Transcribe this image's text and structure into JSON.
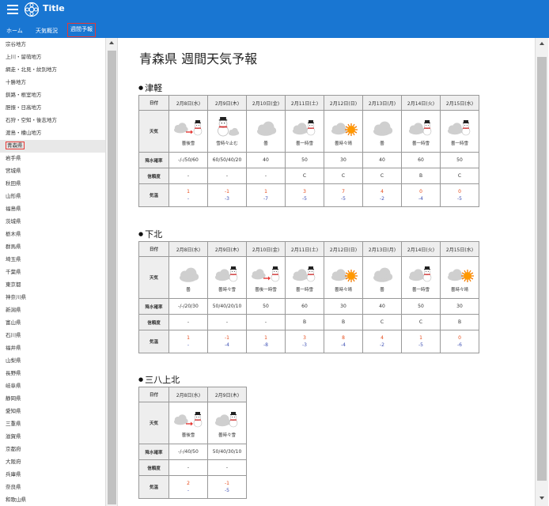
{
  "app": {
    "title": "Title"
  },
  "nav": {
    "tabs": [
      {
        "label": "ホーム"
      },
      {
        "label": "天気概況"
      },
      {
        "label": "週間予報"
      }
    ]
  },
  "sidebar": {
    "items": [
      "宗谷地方",
      "上川・留萌地方",
      "網走・北見・紋別地方",
      "十勝地方",
      "釧路・根室地方",
      "胆振・日高地方",
      "石狩・空知・後志地方",
      "渡島・檜山地方",
      "青森県",
      "岩手県",
      "宮城県",
      "秋田県",
      "山形県",
      "福島県",
      "茨城県",
      "栃木県",
      "群馬県",
      "埼玉県",
      "千葉県",
      "東京都",
      "神奈川県",
      "新潟県",
      "富山県",
      "石川県",
      "福井県",
      "山梨県",
      "長野県",
      "岐阜県",
      "静岡県",
      "愛知県",
      "三重県",
      "滋賀県",
      "京都府",
      "大阪府",
      "兵庫県",
      "奈良県",
      "和歌山県"
    ],
    "selected_index": 8
  },
  "page": {
    "title": "青森県 週間天気予報"
  },
  "labels": {
    "date": "日付",
    "weather": "天気",
    "pop": "降水確率",
    "reliability": "信頼度",
    "temp": "気温"
  },
  "colors": {
    "topbar": "#1976d2",
    "max_temp": "#e64a19",
    "min_temp": "#3f51b5",
    "selected_border": "#e53935"
  },
  "regions": [
    {
      "name": "津軽",
      "days": [
        {
          "date": "2月8日(水)",
          "icon": "cloudy-then-snow-icon",
          "weather": "曇後雪",
          "pop": "-/-/50/60",
          "rel": "-",
          "max": "1",
          "min": "-"
        },
        {
          "date": "2月9日(木)",
          "icon": "snow-sometimes-cloudy-icon",
          "weather": "雪時々止む",
          "pop": "60/50/40/20",
          "rel": "-",
          "max": "-1",
          "min": "-3"
        },
        {
          "date": "2月10日(金)",
          "icon": "cloudy-icon",
          "weather": "曇",
          "pop": "40",
          "rel": "-",
          "max": "1",
          "min": "-7"
        },
        {
          "date": "2月11日(土)",
          "icon": "cloudy-occasional-snow-icon",
          "weather": "曇一時雪",
          "pop": "50",
          "rel": "C",
          "max": "3",
          "min": "-5"
        },
        {
          "date": "2月12日(日)",
          "icon": "cloudy-sometimes-sunny-icon",
          "weather": "曇時々晴",
          "pop": "30",
          "rel": "C",
          "max": "7",
          "min": "-5"
        },
        {
          "date": "2月13日(月)",
          "icon": "cloudy-icon",
          "weather": "曇",
          "pop": "40",
          "rel": "C",
          "max": "4",
          "min": "-2"
        },
        {
          "date": "2月14日(火)",
          "icon": "cloudy-occasional-snow-icon",
          "weather": "曇一時雪",
          "pop": "60",
          "rel": "B",
          "max": "0",
          "min": "-4"
        },
        {
          "date": "2月15日(水)",
          "icon": "cloudy-occasional-snow-icon",
          "weather": "曇一時雪",
          "pop": "50",
          "rel": "C",
          "max": "0",
          "min": "-5"
        }
      ]
    },
    {
      "name": "下北",
      "days": [
        {
          "date": "2月8日(水)",
          "icon": "cloudy-icon",
          "weather": "曇",
          "pop": "-/-/20/30",
          "rel": "-",
          "max": "1",
          "min": "-"
        },
        {
          "date": "2月9日(木)",
          "icon": "cloudy-occasional-snow-icon",
          "weather": "曇時々雪",
          "pop": "50/40/20/10",
          "rel": "-",
          "max": "-1",
          "min": "-4"
        },
        {
          "date": "2月10日(金)",
          "icon": "cloudy-then-snow-icon",
          "weather": "曇後一時雪",
          "pop": "50",
          "rel": "-",
          "max": "1",
          "min": "-8"
        },
        {
          "date": "2月11日(土)",
          "icon": "cloudy-occasional-snow-icon",
          "weather": "曇一時雪",
          "pop": "60",
          "rel": "B",
          "max": "3",
          "min": "-3"
        },
        {
          "date": "2月12日(日)",
          "icon": "cloudy-sometimes-sunny-icon",
          "weather": "曇時々晴",
          "pop": "30",
          "rel": "B",
          "max": "8",
          "min": "-4"
        },
        {
          "date": "2月13日(月)",
          "icon": "cloudy-icon",
          "weather": "曇",
          "pop": "40",
          "rel": "C",
          "max": "4",
          "min": "-2"
        },
        {
          "date": "2月14日(火)",
          "icon": "cloudy-occasional-snow-icon",
          "weather": "曇一時雪",
          "pop": "50",
          "rel": "C",
          "max": "1",
          "min": "-5"
        },
        {
          "date": "2月15日(水)",
          "icon": "cloudy-sometimes-sunny-icon",
          "weather": "曇時々晴",
          "pop": "30",
          "rel": "B",
          "max": "0",
          "min": "-6"
        }
      ]
    },
    {
      "name": "三八上北",
      "days": [
        {
          "date": "2月8日(水)",
          "icon": "cloudy-then-snow-icon",
          "weather": "曇後雪",
          "pop": "-/-/40/50",
          "rel": "-",
          "max": "2",
          "min": "-"
        },
        {
          "date": "2月9日(木)",
          "icon": "cloudy-occasional-snow-icon",
          "weather": "曇時々雪",
          "pop": "50/40/30/10",
          "rel": "-",
          "max": "-1",
          "min": "-5"
        }
      ]
    }
  ]
}
